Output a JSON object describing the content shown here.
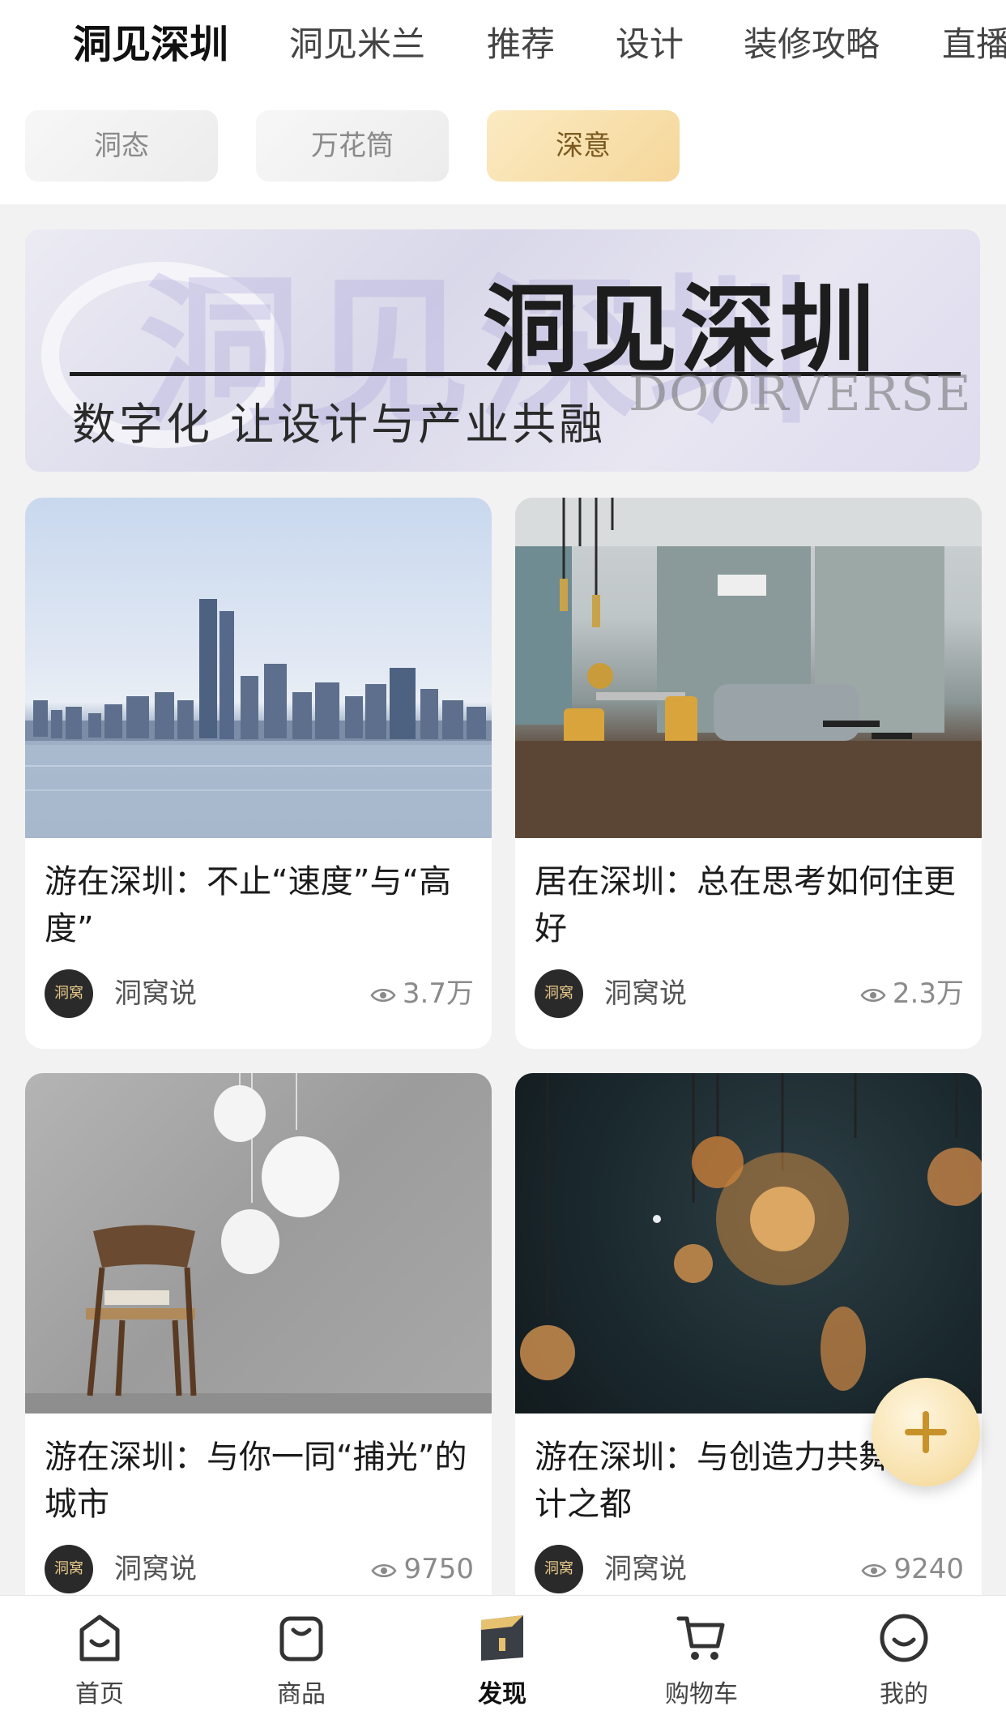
{
  "top_tabs": [
    {
      "label": "洞见深圳",
      "active": true
    },
    {
      "label": "洞见米兰"
    },
    {
      "label": "推荐"
    },
    {
      "label": "设计"
    },
    {
      "label": "装修攻略"
    },
    {
      "label": "直播"
    }
  ],
  "chips": [
    {
      "label": "洞态"
    },
    {
      "label": "万花筒"
    },
    {
      "label": "深意",
      "selected": true
    }
  ],
  "banner": {
    "title": "洞见深圳",
    "subtitle": "数字化 让设计与产业共融",
    "brand": "DOORVERSE"
  },
  "cards": [
    {
      "title": "游在深圳：不止“速度”与“高度”",
      "author": "洞窝说",
      "views": "3.7万",
      "image": "city-skyline"
    },
    {
      "title": "居在深圳：总在思考如何住更好",
      "author": "洞窝说",
      "views": "2.3万",
      "image": "living-room"
    },
    {
      "title": "游在深圳：与你一同“捕光”的城市",
      "author": "洞窝说",
      "views": "9750",
      "image": "pendant-lamps-chair"
    },
    {
      "title": "游在深圳：与创造力共舞的设计之都",
      "author": "洞窝说",
      "views": "9240",
      "image": "edison-bulbs"
    }
  ],
  "avatar_text": "洞窝",
  "fab": {
    "icon": "plus-icon"
  },
  "bottom_nav": [
    {
      "label": "首页",
      "icon": "home-icon"
    },
    {
      "label": "商品",
      "icon": "bag-icon"
    },
    {
      "label": "发现",
      "icon": "discover-icon",
      "active": true
    },
    {
      "label": "购物车",
      "icon": "cart-icon"
    },
    {
      "label": "我的",
      "icon": "profile-icon"
    }
  ],
  "colors": {
    "accent": "#f0c25e",
    "chip_selected": "#f7dfa8",
    "background": "#f3f2f2"
  }
}
